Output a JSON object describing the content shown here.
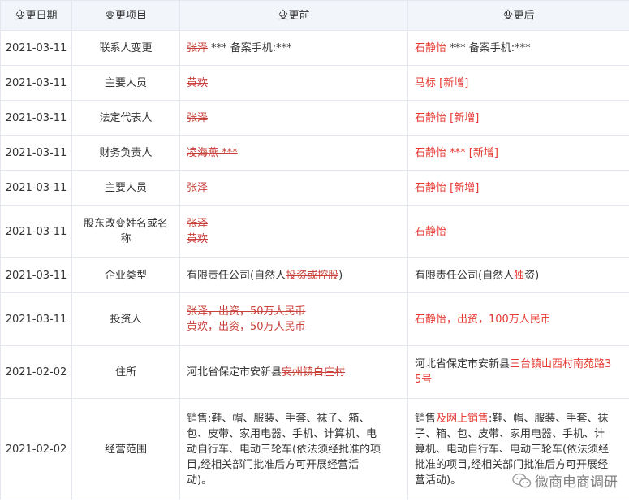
{
  "headers": {
    "date": "变更日期",
    "item": "变更项目",
    "before": "变更前",
    "after": "变更后"
  },
  "rows": [
    {
      "date": "2021-03-11",
      "item": [
        "联系人变更"
      ],
      "before": [
        [
          {
            "t": "张泽",
            "s": "del"
          },
          {
            "t": " *** 备案手机:***",
            "s": ""
          }
        ]
      ],
      "after": [
        [
          {
            "t": "石静怡",
            "s": "add"
          },
          {
            "t": " *** 备案手机:***",
            "s": ""
          }
        ]
      ]
    },
    {
      "date": "2021-03-11",
      "item": [
        "主要人员"
      ],
      "before": [
        [
          {
            "t": "黄欢",
            "s": "del"
          }
        ]
      ],
      "after": [
        [
          {
            "t": "马标 [新增]",
            "s": "add"
          }
        ]
      ]
    },
    {
      "date": "2021-03-11",
      "item": [
        "法定代表人"
      ],
      "before": [
        [
          {
            "t": "张泽",
            "s": "del"
          }
        ]
      ],
      "after": [
        [
          {
            "t": "石静怡 [新增]",
            "s": "add"
          }
        ]
      ]
    },
    {
      "date": "2021-03-11",
      "item": [
        "财务负责人"
      ],
      "before": [
        [
          {
            "t": "凌海燕 ***",
            "s": "del"
          }
        ]
      ],
      "after": [
        [
          {
            "t": "石静怡 *** [新增]",
            "s": "add"
          }
        ]
      ]
    },
    {
      "date": "2021-03-11",
      "item": [
        "主要人员"
      ],
      "before": [
        [
          {
            "t": "张泽",
            "s": "del"
          }
        ]
      ],
      "after": [
        [
          {
            "t": "石静怡 [新增]",
            "s": "add"
          }
        ]
      ]
    },
    {
      "date": "2021-03-11",
      "item": [
        "股东改变姓名或名",
        "称"
      ],
      "before": [
        [
          {
            "t": "张泽",
            "s": "del"
          }
        ],
        [
          {
            "t": "黄欢",
            "s": "del"
          }
        ]
      ],
      "after": [
        [
          {
            "t": "石静怡",
            "s": "add"
          }
        ]
      ]
    },
    {
      "date": "2021-03-11",
      "item": [
        "企业类型"
      ],
      "before": [
        [
          {
            "t": "有限责任公司(自然人",
            "s": ""
          },
          {
            "t": "投资或控股",
            "s": "del"
          },
          {
            "t": ")",
            "s": ""
          }
        ]
      ],
      "after": [
        [
          {
            "t": "有限责任公司(自然人",
            "s": ""
          },
          {
            "t": "独",
            "s": "add"
          },
          {
            "t": "资)",
            "s": ""
          }
        ]
      ]
    },
    {
      "date": "2021-03-11",
      "item": [
        "投资人"
      ],
      "before": [
        [
          {
            "t": "张泽，出资，50万人民币",
            "s": "del"
          }
        ],
        [
          {
            "t": "黄欢，出资，50万人民币",
            "s": "del"
          }
        ]
      ],
      "after": [
        [
          {
            "t": "石静怡，出资，100万人民币",
            "s": "add"
          }
        ]
      ]
    },
    {
      "date": "2021-02-02",
      "item": [
        "住所"
      ],
      "before": [
        [
          {
            "t": "河北省保定市安新县",
            "s": ""
          },
          {
            "t": "安州镇白庄村",
            "s": "del"
          }
        ]
      ],
      "after": [
        [
          {
            "t": "河北省保定市安新县",
            "s": ""
          },
          {
            "t": "三台镇山西村南苑路3",
            "s": "add"
          }
        ],
        [
          {
            "t": "5号",
            "s": "add"
          }
        ]
      ]
    },
    {
      "date": "2021-02-02",
      "item": [
        "经营范围"
      ],
      "before": [
        [
          {
            "t": "销售:鞋、帽、服装、手套、袜子、箱、",
            "s": ""
          }
        ],
        [
          {
            "t": "包、皮带、家用电器、手机、计算机、电",
            "s": ""
          }
        ],
        [
          {
            "t": "动自行车、电动三轮车(依法须经批准的项",
            "s": ""
          }
        ],
        [
          {
            "t": "目,经相关部门批准后方可开展经营活",
            "s": ""
          }
        ],
        [
          {
            "t": "动)。",
            "s": ""
          }
        ]
      ],
      "after": [
        [
          {
            "t": "销售",
            "s": ""
          },
          {
            "t": "及网上销售",
            "s": "add"
          },
          {
            "t": ":鞋、帽、服装、手套、袜",
            "s": ""
          }
        ],
        [
          {
            "t": "子、箱、包、皮带、家用电器、手机、计",
            "s": ""
          }
        ],
        [
          {
            "t": "算机、电动自行车、电动三轮车(依法须经",
            "s": ""
          }
        ],
        [
          {
            "t": "批准的项目,经相关部门批准后方可开展经",
            "s": ""
          }
        ],
        [
          {
            "t": "营活动)。",
            "s": ""
          }
        ]
      ]
    }
  ],
  "watermark": {
    "text": "微商电商调研",
    "icon": "wechat-icon"
  },
  "colors": {
    "added": "#e63a33",
    "removed": "#c8403a",
    "header_bg": "#f2f5fa",
    "border": "#e4e8ee"
  }
}
